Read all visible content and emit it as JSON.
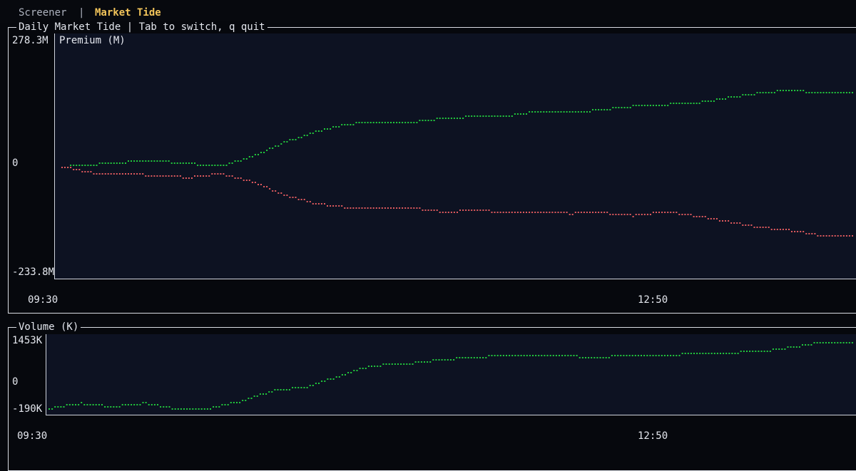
{
  "tabs": {
    "screener": "Screener",
    "separator": "|",
    "market_tide": "Market Tide"
  },
  "panel_premium": {
    "title": "Daily Market Tide | Tab to switch, q quit",
    "chart_title": "Premium (M)",
    "y_max_label": "278.3M",
    "y_zero_label": "0",
    "y_min_label": "-233.8M",
    "x_start_label": "09:30",
    "x_mid_label": "12:50"
  },
  "panel_volume": {
    "title": "Volume (K)",
    "y_max_label": "1453K",
    "y_zero_label": "0",
    "y_min_label": "-190K",
    "x_start_label": "09:30",
    "x_mid_label": "12:50"
  },
  "colors": {
    "call": "#22c93d",
    "put": "#e05a5e",
    "highlight": "#f2c45a"
  },
  "chart_data": [
    {
      "type": "line",
      "title": "Premium (M)",
      "ylim": [
        -233.8,
        278.3
      ],
      "x_tick_labels": [
        "09:30",
        "12:50"
      ],
      "series": [
        {
          "values": [
            0,
            5,
            11,
            14,
            7,
            2,
            24,
            58,
            84,
            102,
            107,
            106,
            116,
            120,
            121,
            133,
            129,
            136,
            145,
            149,
            153,
            165,
            177,
            183,
            176,
            177
          ]
        },
        {
          "values": [
            0,
            -15,
            -19,
            -20,
            -26,
            -17,
            -35,
            -68,
            -88,
            -98,
            -101,
            -98,
            -108,
            -105,
            -108,
            -107,
            -112,
            -110,
            -117,
            -108,
            -118,
            -132,
            -145,
            -153,
            -166,
            -163
          ]
        }
      ]
    },
    {
      "type": "line",
      "title": "Volume (K)",
      "ylim": [
        -190,
        1453
      ],
      "x_tick_labels": [
        "09:30",
        "12:50"
      ],
      "series": [
        {
          "values": [
            -160,
            -40,
            -120,
            -30,
            -190,
            -150,
            20,
            280,
            350,
            620,
            870,
            900,
            1000,
            1060,
            1100,
            1100,
            1100,
            1060,
            1120,
            1120,
            1150,
            1180,
            1200,
            1300,
            1430,
            1390
          ]
        }
      ]
    }
  ]
}
